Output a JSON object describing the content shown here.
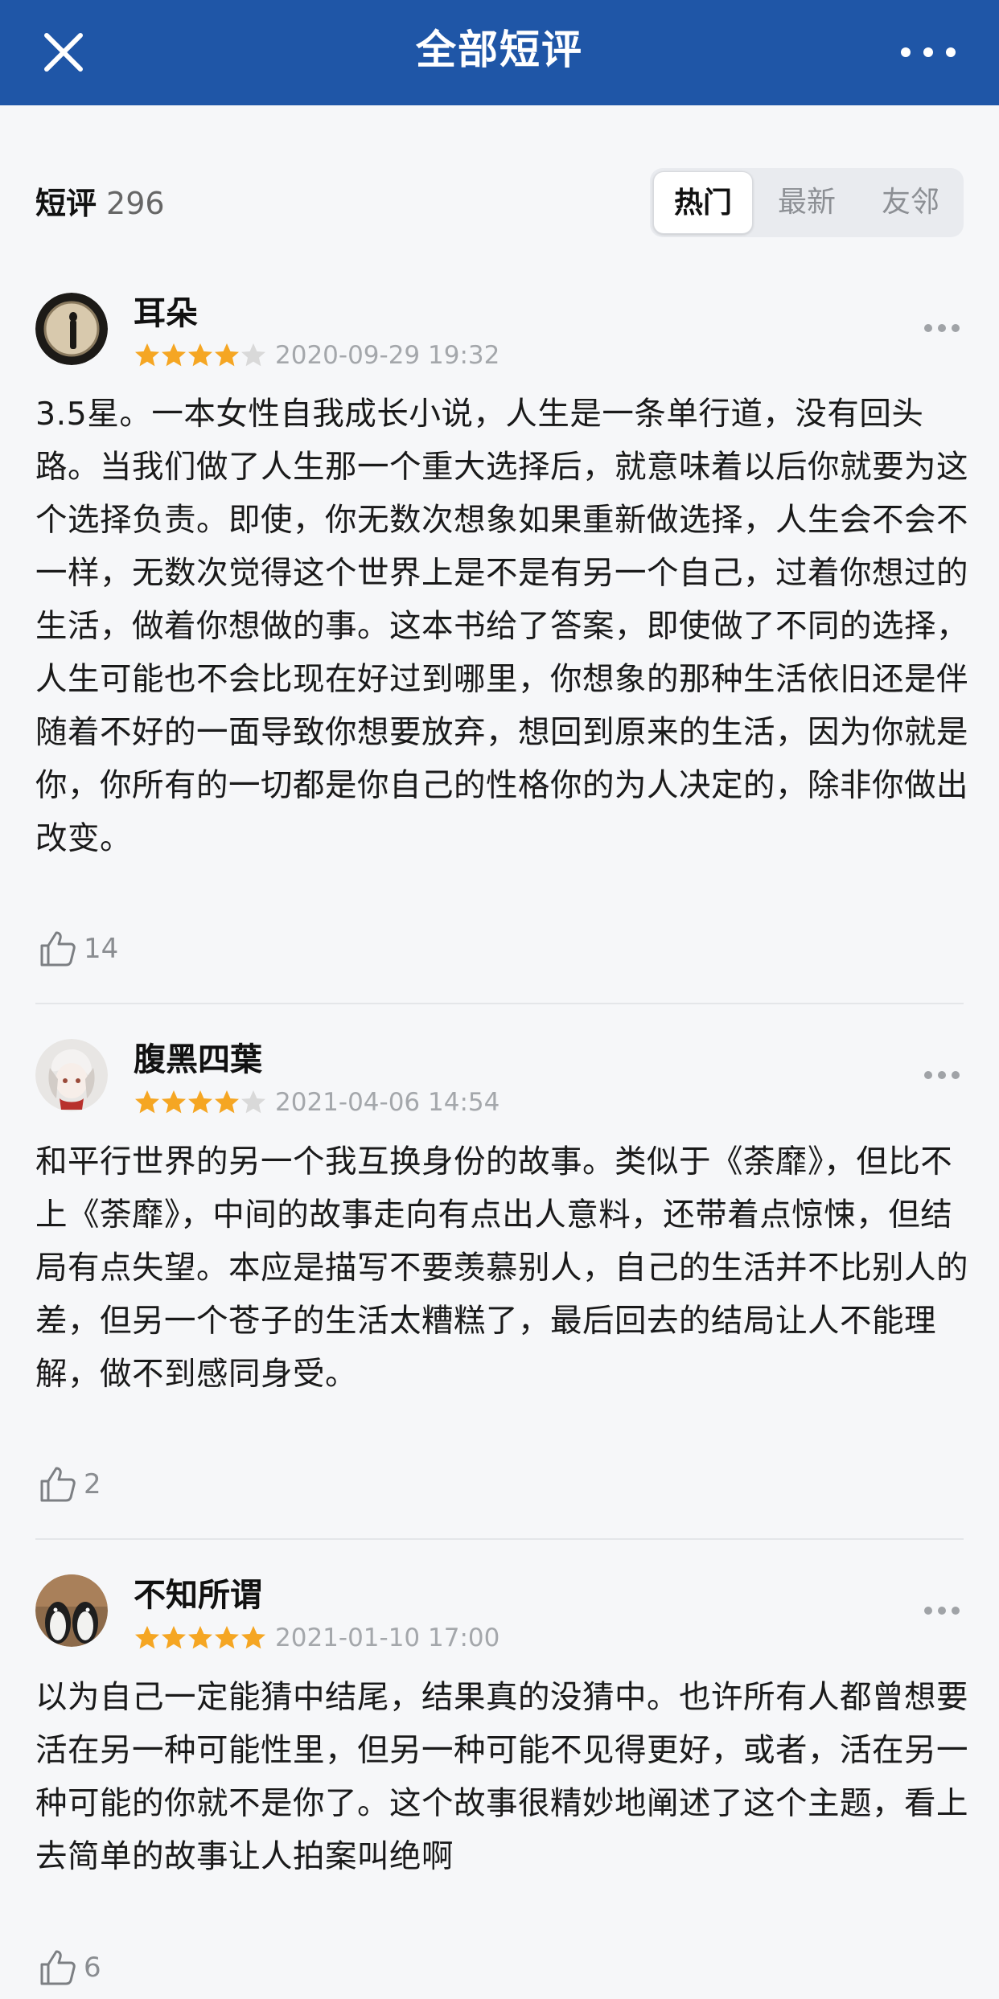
{
  "header": {
    "title": "全部短评",
    "close_icon": "close-icon",
    "more_icon": "more-horizontal-icon"
  },
  "summary": {
    "label": "短评",
    "count": "296"
  },
  "tabs": [
    {
      "label": "热门",
      "active": true
    },
    {
      "label": "最新",
      "active": false
    },
    {
      "label": "友邻",
      "active": false
    }
  ],
  "reviews": [
    {
      "user": "耳朵",
      "rating": 4,
      "date": "2020-09-29 19:32",
      "text": "3.5星。一本女性自我成长小说，人生是一条单行道，没有回头路。当我们做了人生那一个重大选择后，就意味着以后你就要为这个选择负责。即使，你无数次想象如果重新做选择，人生会不会不一样，无数次觉得这个世界上是不是有另一个自己，过着你想过的生活，做着你想做的事。这本书给了答案，即使做了不同的选择，人生可能也不会比现在好过到哪里，你想象的那种生活依旧还是伴随着不好的一面导致你想要放弃，想回到原来的生活，因为你就是你，你所有的一切都是你自己的性格你的为人决定的，除非你做出改变。",
      "likes": "14"
    },
    {
      "user": "腹黑四葉",
      "rating": 4,
      "date": "2021-04-06 14:54",
      "text": "和平行世界的另一个我互换身份的故事。类似于《荼靡》，但比不上《荼靡》，中间的故事走向有点出人意料，还带着点惊悚，但结局有点失望。本应是描写不要羡慕别人，自己的生活并不比别人的差，但另一个苍子的生活太糟糕了，最后回去的结局让人不能理解，做不到感同身受。",
      "likes": "2"
    },
    {
      "user": "不知所谓",
      "rating": 5,
      "date": "2021-01-10 17:00",
      "text": "以为自己一定能猜中结尾，结果真的没猜中。也许所有人都曾想要活在另一种可能性里，但另一种可能不见得更好，或者，活在另一种可能的你就不是你了。这个故事很精妙地阐述了这个主题，看上去简单的故事让人拍案叫绝啊",
      "likes": "6"
    }
  ],
  "colors": {
    "nav_bg": "#1f56a7",
    "star": "#f5a623",
    "star_empty": "#d9d9d9"
  }
}
